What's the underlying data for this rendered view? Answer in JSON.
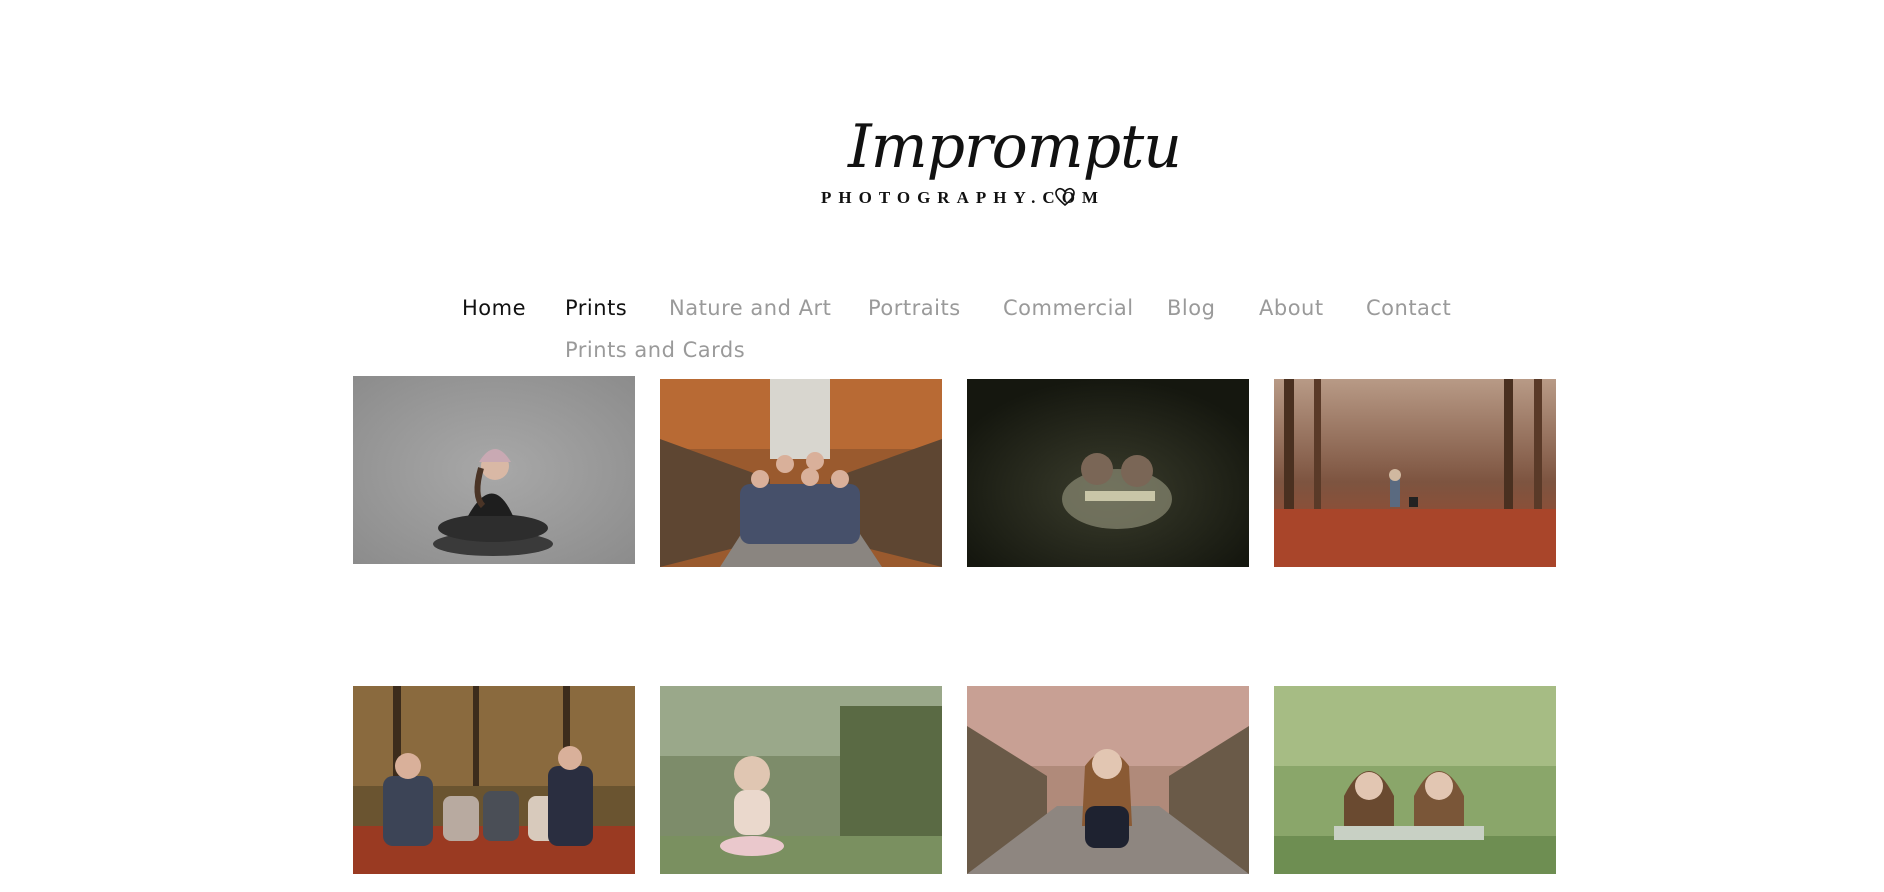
{
  "logo": {
    "script_text": "Impromptu",
    "sub_text": "PHOTOGRAPHY.COM"
  },
  "nav": {
    "items": [
      {
        "label": "Home",
        "active": true
      },
      {
        "label": "Prints",
        "active": true
      },
      {
        "label": "Nature and Art",
        "active": false
      },
      {
        "label": "Portraits",
        "active": false
      },
      {
        "label": "Commercial",
        "active": false
      },
      {
        "label": "Blog",
        "active": false
      },
      {
        "label": "About",
        "active": false
      },
      {
        "label": "Contact",
        "active": false
      }
    ],
    "submenu": {
      "label": "Prints and Cards"
    }
  },
  "gallery": {
    "photos": [
      {
        "subject": "girl-on-pillows-grey-backdrop"
      },
      {
        "subject": "family-on-bridge-autumn"
      },
      {
        "subject": "two-girls-reading-dark"
      },
      {
        "subject": "child-and-dog-autumn-forest"
      },
      {
        "subject": "family-with-babies-leaves"
      },
      {
        "subject": "baby-in-garden"
      },
      {
        "subject": "girl-lying-on-path"
      },
      {
        "subject": "two-sisters-in-grass"
      }
    ]
  },
  "colors": {
    "nav_active": "#111111",
    "nav_inactive": "#9a9a9a",
    "background": "#ffffff"
  }
}
